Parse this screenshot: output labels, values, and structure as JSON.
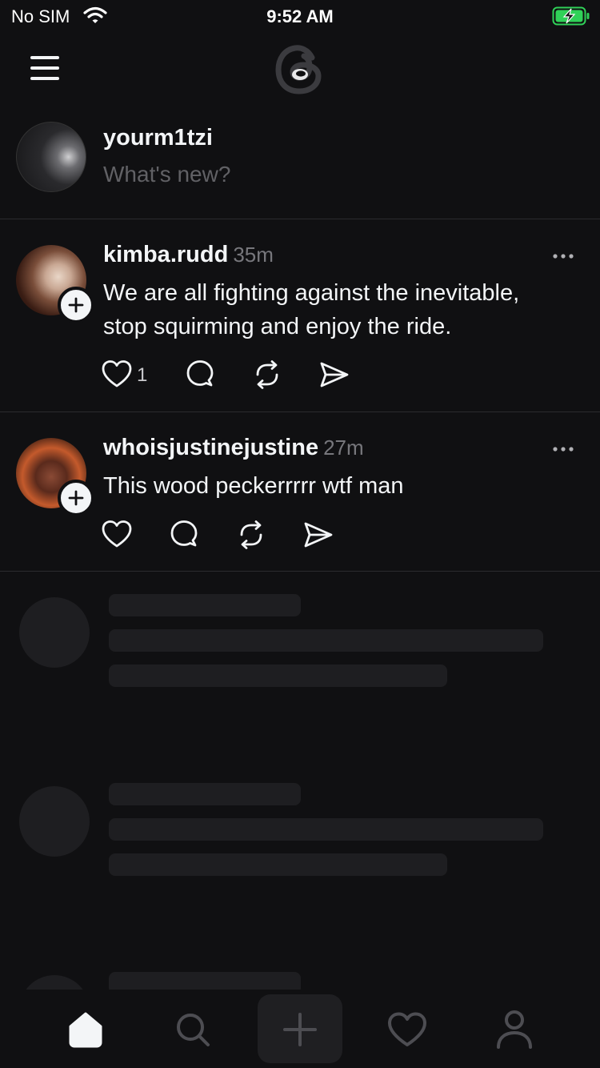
{
  "status_bar": {
    "carrier": "No SIM",
    "time": "9:52 AM",
    "battery_color": "#30d158"
  },
  "header": {
    "menu_icon": "hamburger-menu-icon",
    "logo_icon": "threads-logo-icon"
  },
  "composer": {
    "username": "yourm1tzi",
    "placeholder": "What's new?"
  },
  "posts": [
    {
      "username": "kimba.rudd",
      "time": "35m",
      "text_lines": [
        "We are all fighting against the inevitable,",
        "stop squirming and enjoy the ride."
      ],
      "like_count": "1"
    },
    {
      "username": "whoisjustinejustine",
      "time": "27m",
      "text_lines": [
        "This wood peckerrrrr wtf man"
      ],
      "like_count": ""
    }
  ],
  "tabbar": {
    "tabs": [
      "home-icon",
      "search-icon",
      "create-icon",
      "activity-heart-icon",
      "profile-icon"
    ],
    "active": "home-icon"
  },
  "colors": {
    "background": "#101012",
    "text": "#f3f5f7",
    "secondary_text": "#77777c",
    "divider": "#2b2b2e",
    "skeleton": "#1e1e21"
  }
}
